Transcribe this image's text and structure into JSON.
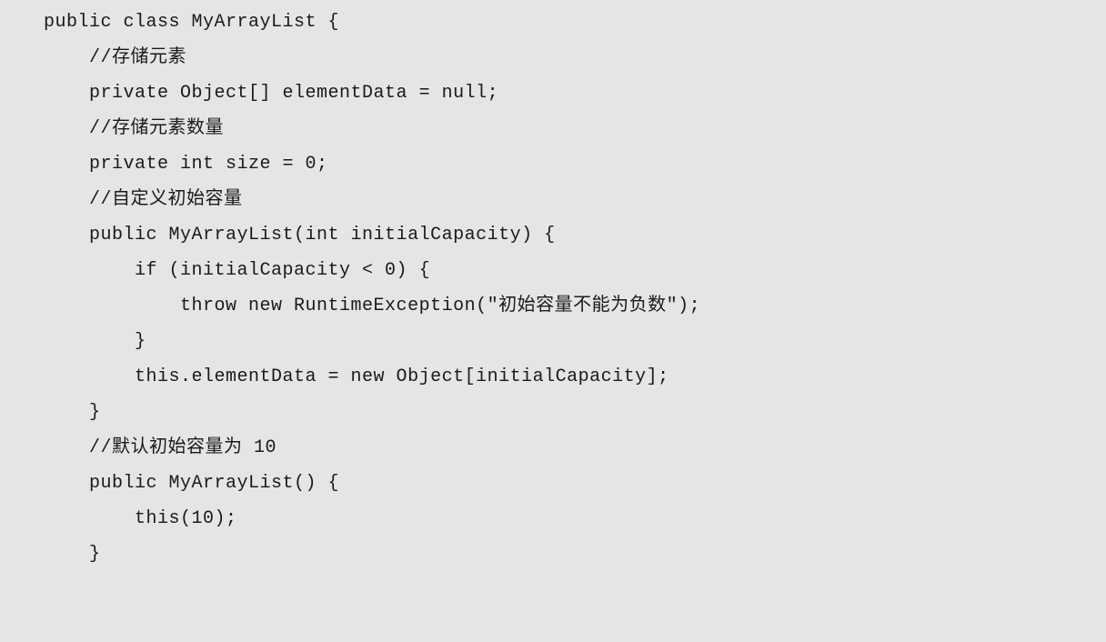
{
  "code": {
    "lines": [
      "public class MyArrayList {",
      "    //存储元素",
      "    private Object[] elementData = null;",
      "    //存储元素数量",
      "    private int size = 0;",
      "",
      "    //自定义初始容量",
      "    public MyArrayList(int initialCapacity) {",
      "        if (initialCapacity < 0) {",
      "            throw new RuntimeException(\"初始容量不能为负数\");",
      "        }",
      "        this.elementData = new Object[initialCapacity];",
      "    }",
      "",
      "    //默认初始容量为 10",
      "    public MyArrayList() {",
      "        this(10);",
      "    }"
    ]
  }
}
